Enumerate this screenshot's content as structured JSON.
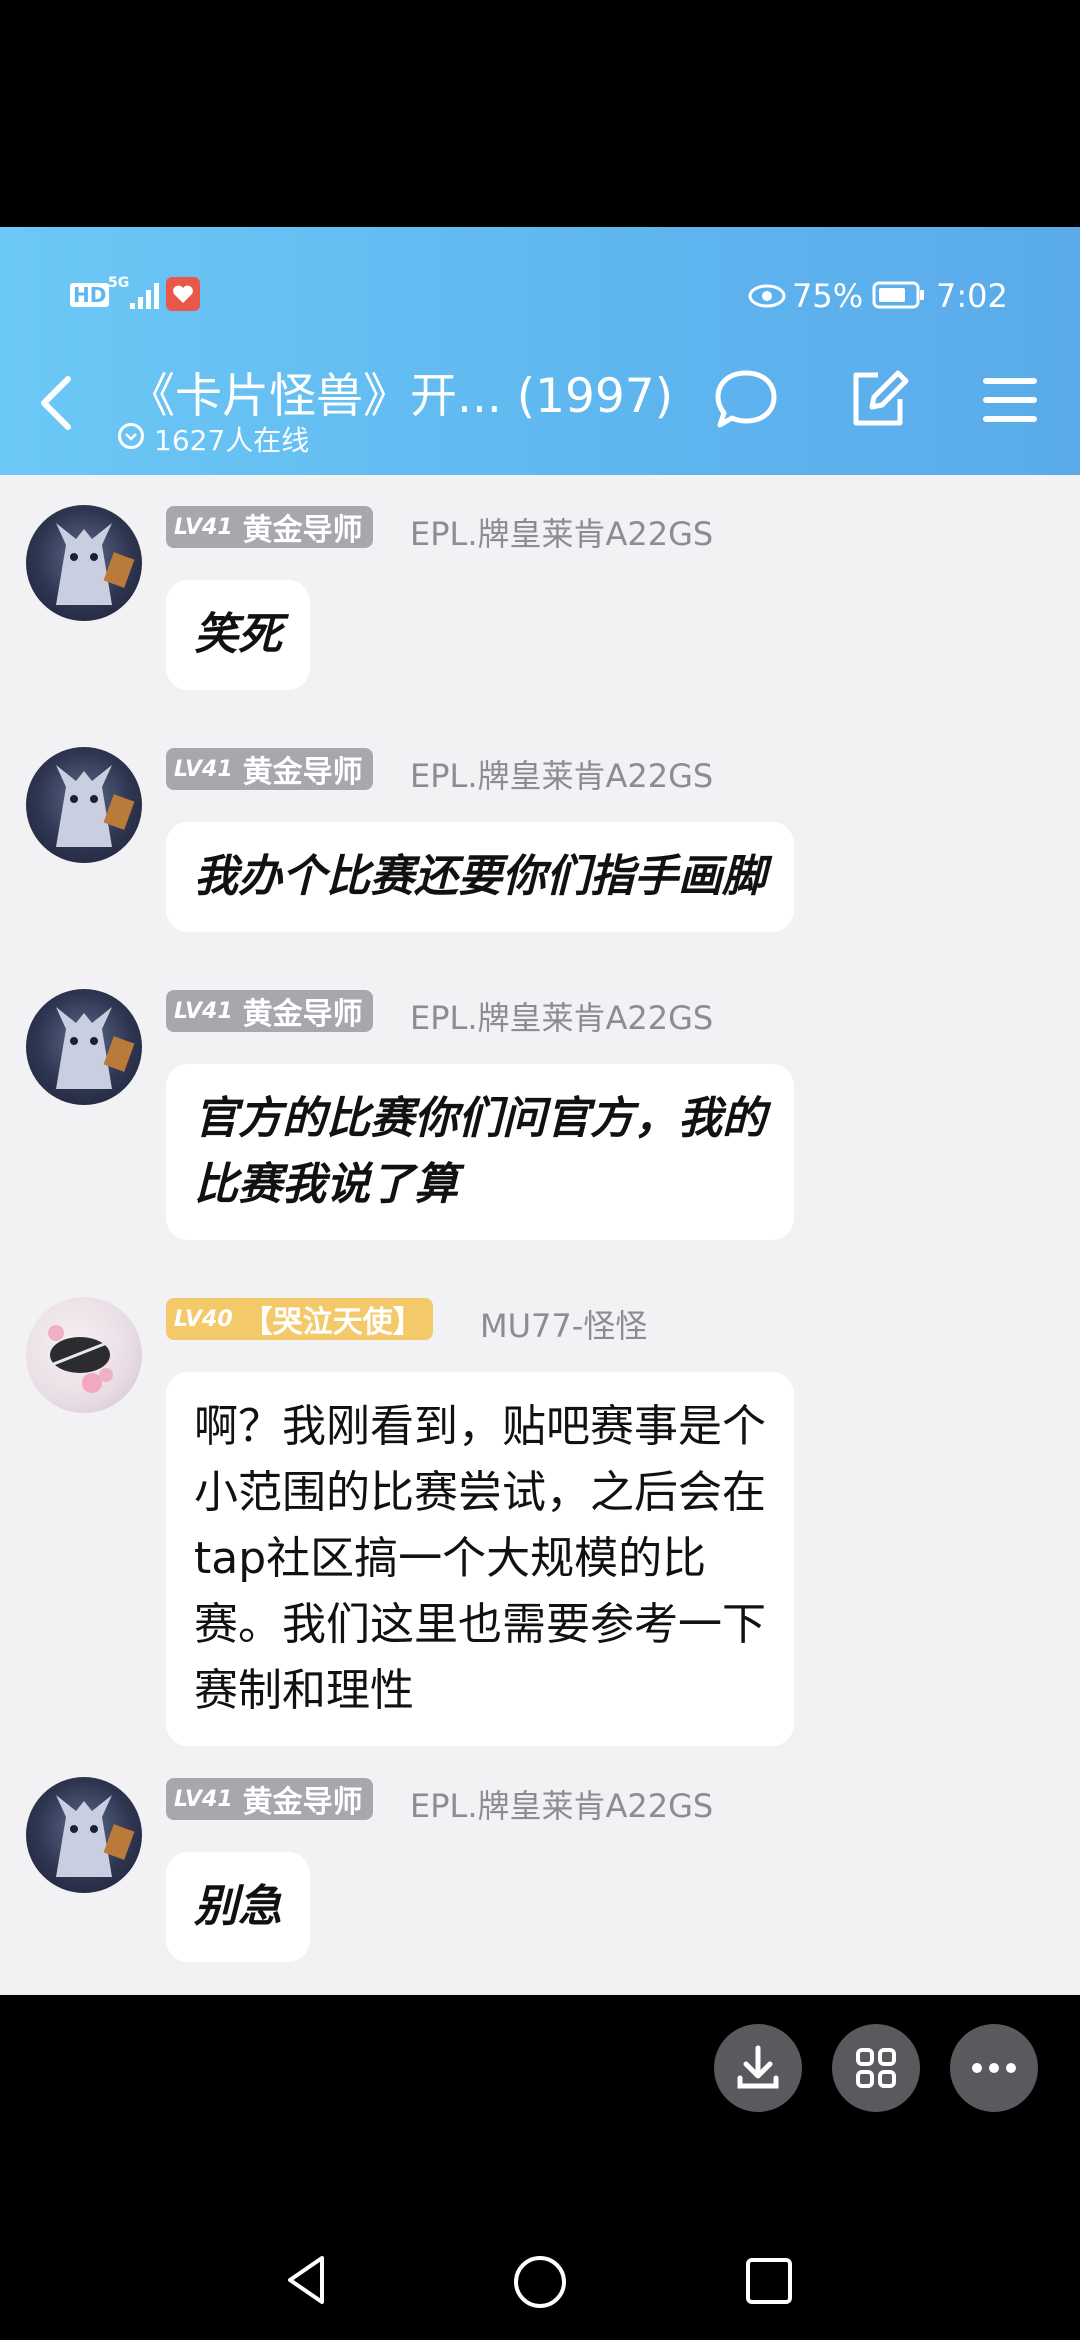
{
  "status_bar": {
    "network_hd": "HD",
    "network_5g": "5G",
    "battery_percent": "75%",
    "time": "7:02"
  },
  "header": {
    "title": "《卡片怪兽》开... (1997)",
    "online_text": "1627人在线"
  },
  "messages": [
    {
      "level": "LV41",
      "title": "黄金导师",
      "user": "EPL.牌皇莱肯A22GS",
      "text": "笑死"
    },
    {
      "level": "LV41",
      "title": "黄金导师",
      "user": "EPL.牌皇莱肯A22GS",
      "text": "我办个比赛还要你们指手画脚"
    },
    {
      "level": "LV41",
      "title": "黄金导师",
      "user": "EPL.牌皇莱肯A22GS",
      "text_line1": "官方的比赛你们问官方，我的",
      "text_line2": "比赛我说了算"
    },
    {
      "level": "LV40",
      "title": "【哭泣天使】",
      "user": "MU77-怪怪",
      "text_line1": "啊？我刚看到，贴吧赛事是个",
      "text_line2": "小范围的比赛尝试，之后会在",
      "text_line3": "tap社区搞一个大规模的比",
      "text_line4": "赛。我们这里也需要参考一下",
      "text_line5": "赛制和理性"
    },
    {
      "level": "LV41",
      "title": "黄金导师",
      "user": "EPL.牌皇莱肯A22GS",
      "text": "别急"
    }
  ],
  "colors": {
    "header_gradient_start": "#6cc8f6",
    "header_gradient_end": "#5aaaea",
    "chat_background": "#f2f2f4",
    "badge_gray": "#a7a7ad",
    "badge_gold": "#f4c96a"
  },
  "icons": [
    "back-icon",
    "chat-bubble-icon",
    "edit-icon",
    "menu-icon",
    "download-icon",
    "grid-icon",
    "more-icon",
    "nav-back-icon",
    "nav-home-icon",
    "nav-recents-icon",
    "eye-icon",
    "battery-icon"
  ]
}
